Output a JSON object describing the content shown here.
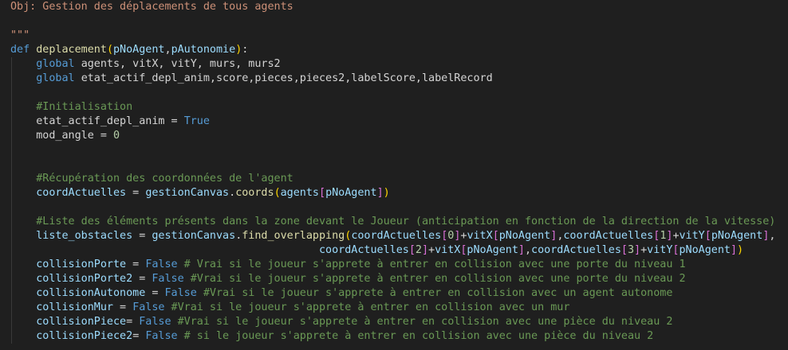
{
  "editor": {
    "lines": [
      [
        {
          "t": "Obj: Gestion des déplacements de tous agents",
          "c": "str"
        }
      ],
      [],
      [
        {
          "t": "\"\"\"",
          "c": "str"
        }
      ],
      [
        {
          "t": "def ",
          "c": "kw"
        },
        {
          "t": "deplacement",
          "c": "fn"
        },
        {
          "t": "(",
          "c": "br1"
        },
        {
          "t": "pNoAgent",
          "c": "var"
        },
        {
          "t": ",",
          "c": "pl"
        },
        {
          "t": "pAutonomie",
          "c": "var"
        },
        {
          "t": ")",
          "c": "br1"
        },
        {
          "t": ":",
          "c": "pl"
        }
      ],
      [
        {
          "t": "    ",
          "c": "pl"
        },
        {
          "t": "global ",
          "c": "kw"
        },
        {
          "t": "agents, vitX, vitY, murs, murs2",
          "c": "pl"
        }
      ],
      [
        {
          "t": "    ",
          "c": "pl"
        },
        {
          "t": "global ",
          "c": "kw"
        },
        {
          "t": "etat_actif_depl_anim,score,pieces,pieces2,labelScore,labelRecord",
          "c": "pl"
        }
      ],
      [],
      [
        {
          "t": "    ",
          "c": "pl"
        },
        {
          "t": "#Initialisation",
          "c": "cm"
        }
      ],
      [
        {
          "t": "    ",
          "c": "pl"
        },
        {
          "t": "etat_actif_depl_anim",
          "c": "pl"
        },
        {
          "t": " = ",
          "c": "pl"
        },
        {
          "t": "True",
          "c": "kw"
        }
      ],
      [
        {
          "t": "    ",
          "c": "pl"
        },
        {
          "t": "mod_angle",
          "c": "pl"
        },
        {
          "t": " = ",
          "c": "pl"
        },
        {
          "t": "0",
          "c": "num"
        }
      ],
      [],
      [],
      [
        {
          "t": "    ",
          "c": "pl"
        },
        {
          "t": "#Récupération des coordonnées de l'agent",
          "c": "cm"
        }
      ],
      [
        {
          "t": "    ",
          "c": "pl"
        },
        {
          "t": "coordActuelles",
          "c": "var"
        },
        {
          "t": " = ",
          "c": "pl"
        },
        {
          "t": "gestionCanvas",
          "c": "var"
        },
        {
          "t": ".",
          "c": "pl"
        },
        {
          "t": "coords",
          "c": "fn"
        },
        {
          "t": "(",
          "c": "br1"
        },
        {
          "t": "agents",
          "c": "var"
        },
        {
          "t": "[",
          "c": "br2"
        },
        {
          "t": "pNoAgent",
          "c": "var"
        },
        {
          "t": "]",
          "c": "br2"
        },
        {
          "t": ")",
          "c": "br1"
        }
      ],
      [],
      [
        {
          "t": "    ",
          "c": "pl"
        },
        {
          "t": "#Liste des éléments présents dans la zone devant le Joueur (anticipation en fonction de la direction de la vitesse)",
          "c": "cm"
        }
      ],
      [
        {
          "t": "    ",
          "c": "pl"
        },
        {
          "t": "liste_obstacles",
          "c": "var"
        },
        {
          "t": " = ",
          "c": "pl"
        },
        {
          "t": "gestionCanvas",
          "c": "var"
        },
        {
          "t": ".",
          "c": "pl"
        },
        {
          "t": "find_overlapping",
          "c": "fn"
        },
        {
          "t": "(",
          "c": "br1"
        },
        {
          "t": "coordActuelles",
          "c": "var"
        },
        {
          "t": "[",
          "c": "br2"
        },
        {
          "t": "0",
          "c": "num"
        },
        {
          "t": "]",
          "c": "br2"
        },
        {
          "t": "+",
          "c": "pl"
        },
        {
          "t": "vitX",
          "c": "var"
        },
        {
          "t": "[",
          "c": "br2"
        },
        {
          "t": "pNoAgent",
          "c": "var"
        },
        {
          "t": "]",
          "c": "br2"
        },
        {
          "t": ",",
          "c": "pl"
        },
        {
          "t": "coordActuelles",
          "c": "var"
        },
        {
          "t": "[",
          "c": "br2"
        },
        {
          "t": "1",
          "c": "num"
        },
        {
          "t": "]",
          "c": "br2"
        },
        {
          "t": "+",
          "c": "pl"
        },
        {
          "t": "vitY",
          "c": "var"
        },
        {
          "t": "[",
          "c": "br2"
        },
        {
          "t": "pNoAgent",
          "c": "var"
        },
        {
          "t": "]",
          "c": "br2"
        },
        {
          "t": ",",
          "c": "pl"
        }
      ],
      [
        {
          "t": "                                                ",
          "c": "pl"
        },
        {
          "t": "coordActuelles",
          "c": "var"
        },
        {
          "t": "[",
          "c": "br2"
        },
        {
          "t": "2",
          "c": "num"
        },
        {
          "t": "]",
          "c": "br2"
        },
        {
          "t": "+",
          "c": "pl"
        },
        {
          "t": "vitX",
          "c": "var"
        },
        {
          "t": "[",
          "c": "br2"
        },
        {
          "t": "pNoAgent",
          "c": "var"
        },
        {
          "t": "]",
          "c": "br2"
        },
        {
          "t": ",",
          "c": "pl"
        },
        {
          "t": "coordActuelles",
          "c": "var"
        },
        {
          "t": "[",
          "c": "br2"
        },
        {
          "t": "3",
          "c": "num"
        },
        {
          "t": "]",
          "c": "br2"
        },
        {
          "t": "+",
          "c": "pl"
        },
        {
          "t": "vitY",
          "c": "var"
        },
        {
          "t": "[",
          "c": "br2"
        },
        {
          "t": "pNoAgent",
          "c": "var"
        },
        {
          "t": "]",
          "c": "br2"
        },
        {
          "t": ")",
          "c": "br1"
        }
      ],
      [
        {
          "t": "    ",
          "c": "pl"
        },
        {
          "t": "collisionPorte",
          "c": "var"
        },
        {
          "t": " = ",
          "c": "pl"
        },
        {
          "t": "False",
          "c": "kw"
        },
        {
          "t": " # Vrai si le joueur s'apprete à entrer en collision avec une porte du niveau 1",
          "c": "cm"
        }
      ],
      [
        {
          "t": "    ",
          "c": "pl"
        },
        {
          "t": "collisionPorte2",
          "c": "var"
        },
        {
          "t": " = ",
          "c": "pl"
        },
        {
          "t": "False",
          "c": "kw"
        },
        {
          "t": " #Vrai si le joueur s'apprete à entrer en collision avec une porte du niveau 2",
          "c": "cm"
        }
      ],
      [
        {
          "t": "    ",
          "c": "pl"
        },
        {
          "t": "collisionAutonome",
          "c": "var"
        },
        {
          "t": " = ",
          "c": "pl"
        },
        {
          "t": "False",
          "c": "kw"
        },
        {
          "t": " #Vrai si le joueur s'apprete à entrer en collision avec un agent autonome",
          "c": "cm"
        }
      ],
      [
        {
          "t": "    ",
          "c": "pl"
        },
        {
          "t": "collisionMur",
          "c": "var"
        },
        {
          "t": " = ",
          "c": "pl"
        },
        {
          "t": "False",
          "c": "kw"
        },
        {
          "t": " #Vrai si le joueur s'apprete à entrer en collision avec un mur",
          "c": "cm"
        }
      ],
      [
        {
          "t": "    ",
          "c": "pl"
        },
        {
          "t": "collisionPiece",
          "c": "var"
        },
        {
          "t": "= ",
          "c": "pl"
        },
        {
          "t": "False",
          "c": "kw"
        },
        {
          "t": " #Vrai si le joueur s'apprete à entrer en collision avec une pièce du niveau 2",
          "c": "cm"
        }
      ],
      [
        {
          "t": "    ",
          "c": "pl"
        },
        {
          "t": "collisionPiece2",
          "c": "var"
        },
        {
          "t": "= ",
          "c": "pl"
        },
        {
          "t": "False",
          "c": "kw"
        },
        {
          "t": " # si le joueur s'apprete à entrer en collision avec une pièce du niveau 2",
          "c": "cm"
        }
      ]
    ]
  }
}
